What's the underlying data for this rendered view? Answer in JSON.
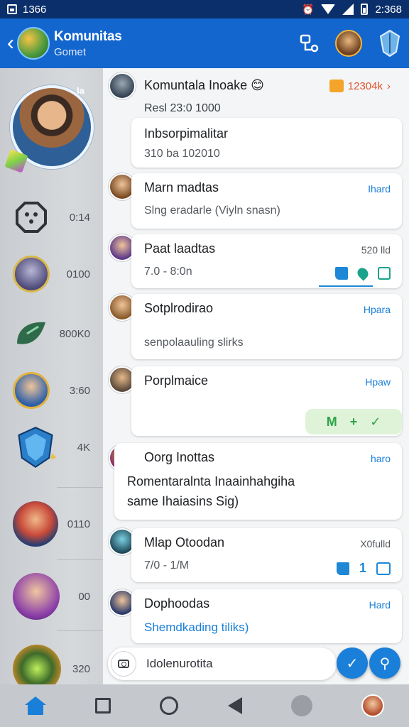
{
  "status_bar": {
    "time_left": "1366",
    "time_right": "2:368"
  },
  "header": {
    "title": "Komunitas",
    "subtitle": "Gomet"
  },
  "sidebar": {
    "hero_label": "Ia",
    "items": [
      {
        "value": "0:14",
        "avatar_color": "#3b3f45"
      },
      {
        "value": "0100",
        "avatar_color": "#4d4a78"
      },
      {
        "value": "800K0",
        "avatar_color": "#2f6b4a"
      },
      {
        "value": "3:60",
        "avatar_color": "#2d5fa8"
      },
      {
        "value": "4K",
        "avatar_color": "#2a7fc8"
      },
      {
        "value": "0110",
        "avatar_color": "#2c3e6e"
      },
      {
        "value": "00",
        "avatar_color": "#8b3fa8"
      },
      {
        "value": "320",
        "avatar_color": "#3d6b2a"
      }
    ]
  },
  "messages": [
    {
      "name": "Komuntala Inoake 😊",
      "chip": "12304k",
      "line1": "Resl 23:0 1000",
      "line2": "Inbsorpimalitar",
      "line3": "310 ba 102010"
    },
    {
      "name": "Marn madtas",
      "tag": "Ihard",
      "line1": "Slng eradarle (Viyln snasn)"
    },
    {
      "name": "Paat laadtas",
      "tag": "520 lld",
      "line1": "7.0 - 8:0n"
    },
    {
      "name": "Sotplrodirao",
      "tag": "Hpara",
      "line1": "senpolaauling slirks"
    },
    {
      "name": "Porplmaice",
      "tag": "Hpaw",
      "green": [
        "M",
        "+",
        "✓"
      ]
    },
    {
      "name": "Oorg Inottas",
      "tag": "haro",
      "line1": "Romentaralnta Inaainhahgiha",
      "line2": "same Ihaiasins Sig)"
    },
    {
      "name": "Mlap Otoodan",
      "tag": "X0fulld",
      "line1": "7/0 - 1/M",
      "num": "1"
    },
    {
      "name": "Dophoodas",
      "tag": "Hard",
      "line1": "Shemdkading tiliks)"
    }
  ],
  "composer": {
    "value": "Idolenurotita"
  },
  "colors": {
    "primary": "#1466cf",
    "accent": "#1a7fd8"
  }
}
